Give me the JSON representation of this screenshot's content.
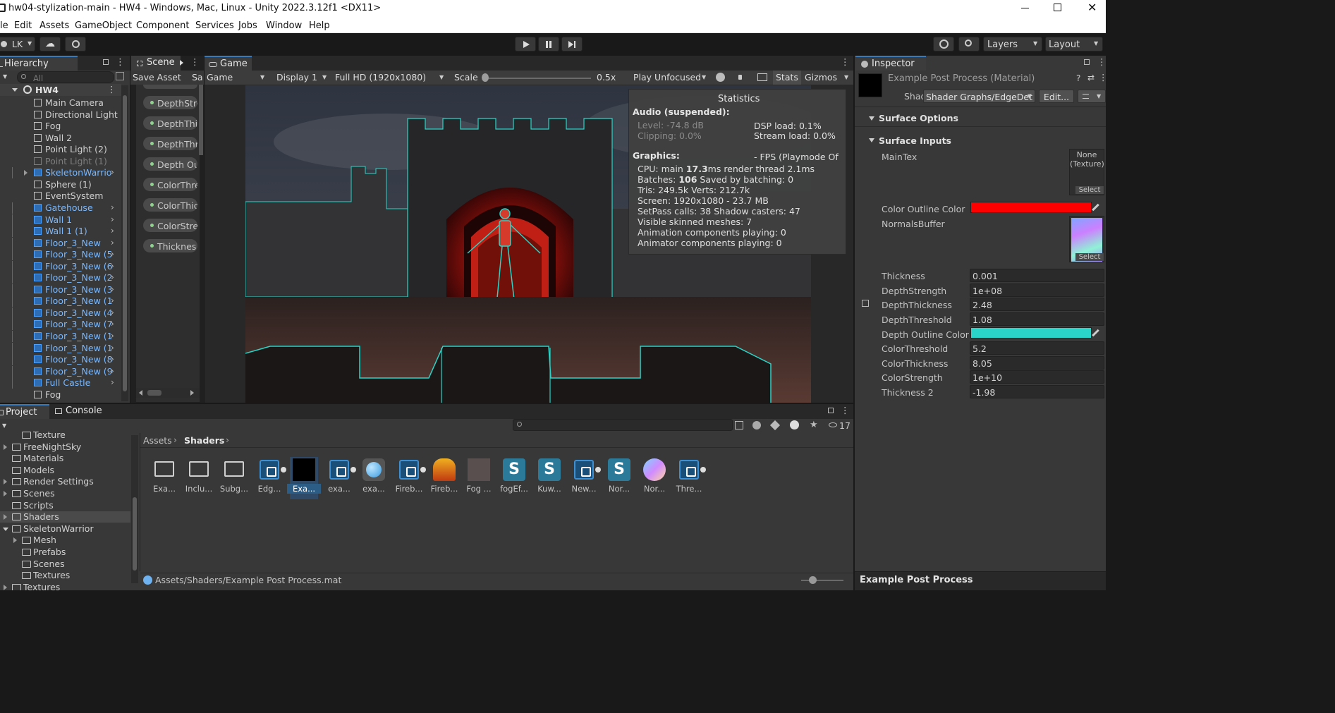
{
  "window": {
    "title": "hw04-stylization-main - HW4 - Windows, Mac, Linux - Unity 2022.3.12f1 <DX11>"
  },
  "menu": [
    "le",
    "Edit",
    "Assets",
    "GameObject",
    "Component",
    "Services",
    "Jobs",
    "Window",
    "Help"
  ],
  "toolbar": {
    "account": "LK",
    "layers": "Layers",
    "layout": "Layout"
  },
  "hierarchy": {
    "tab": "Hierarchy",
    "search_placeholder": "All",
    "scene": "HW4",
    "items": [
      {
        "label": "Main Camera",
        "style": "normal"
      },
      {
        "label": "Directional Light",
        "style": "normal"
      },
      {
        "label": "Fog",
        "style": "normal"
      },
      {
        "label": "Wall 2",
        "style": "normal"
      },
      {
        "label": "Point Light (2)",
        "style": "normal"
      },
      {
        "label": "Point Light (1)",
        "style": "gray"
      },
      {
        "label": "SkeletonWarrio",
        "style": "blue"
      },
      {
        "label": "Sphere (1)",
        "style": "normal"
      },
      {
        "label": "EventSystem",
        "style": "normal"
      },
      {
        "label": "Gatehouse",
        "style": "blue"
      },
      {
        "label": "Wall 1",
        "style": "blue"
      },
      {
        "label": "Wall 1 (1)",
        "style": "blue"
      },
      {
        "label": "Floor_3_New",
        "style": "blue"
      },
      {
        "label": "Floor_3_New (5",
        "style": "blue"
      },
      {
        "label": "Floor_3_New (6",
        "style": "blue"
      },
      {
        "label": "Floor_3_New (2",
        "style": "blue"
      },
      {
        "label": "Floor_3_New (3",
        "style": "blue"
      },
      {
        "label": "Floor_3_New (1",
        "style": "blue"
      },
      {
        "label": "Floor_3_New (4",
        "style": "blue"
      },
      {
        "label": "Floor_3_New (7",
        "style": "blue"
      },
      {
        "label": "Floor_3_New (1",
        "style": "blue"
      },
      {
        "label": "Floor_3_New (1",
        "style": "blue"
      },
      {
        "label": "Floor_3_New (8",
        "style": "blue"
      },
      {
        "label": "Floor_3_New (9",
        "style": "blue"
      },
      {
        "label": "Full Castle",
        "style": "blue"
      },
      {
        "label": "Fog",
        "style": "normal"
      }
    ]
  },
  "scene": {
    "tab": "Scene",
    "save_asset": "Save Asset",
    "sa": "Sa",
    "props": [
      "DepthStre",
      "DepthThic",
      "DepthThre",
      "Depth Out",
      "ColorThre",
      "ColorThic",
      "ColorStre",
      "Thicknes"
    ]
  },
  "game": {
    "tab": "Game",
    "view": "Game",
    "display": "Display 1",
    "resolution": "Full HD (1920x1080)",
    "scale_label": "Scale",
    "scale_value": "0.5x",
    "play_mode": "Play Unfocused",
    "stats": "Stats",
    "gizmos": "Gizmos"
  },
  "stats": {
    "title": "Statistics",
    "audio_header": "Audio (suspended):",
    "level": "Level: -74.8 dB",
    "clipping": "Clipping: 0.0%",
    "dsp": "DSP load: 0.1%",
    "stream": "Stream load: 0.0%",
    "graphics_header": "Graphics:",
    "fps": "- FPS (Playmode Of",
    "cpu_a": "CPU: main ",
    "cpu_b": "17.3",
    "cpu_c": "ms  render thread 2.1ms",
    "batches_a": "Batches: ",
    "batches_b": "106",
    "batches_c": "   Saved by batching: 0",
    "tris": "Tris: 249.5k      Verts: 212.7k",
    "screen": "Screen: 1920x1080 - 23.7 MB",
    "setpass": "SetPass calls: 38          Shadow casters: 47",
    "skinned": "Visible skinned meshes: 7",
    "anim": "Animation components playing: 0",
    "animator": "Animator components playing: 0"
  },
  "inspector": {
    "tab": "Inspector",
    "material": "Example Post Process (Material)",
    "shader_label": "Shader",
    "shader_value": "Shader Graphs/EdgeDet",
    "edit": "Edit...",
    "surface_options": "Surface Options",
    "surface_inputs": "Surface Inputs",
    "maintex": "MainTex",
    "none_texture": "None\n(Texture)",
    "select": "Select",
    "color_outline": "Color Outline Color",
    "color_outline_hex": "#ff0000",
    "normals_buffer": "NormalsBuffer",
    "fields": [
      {
        "label": "Thickness",
        "value": "0.001"
      },
      {
        "label": "DepthStrength",
        "value": "1e+08"
      },
      {
        "label": "DepthThickness",
        "value": "2.48"
      },
      {
        "label": "DepthThreshold",
        "value": "1.08"
      }
    ],
    "depth_outline": "Depth Outline Color",
    "depth_outline_hex": "#2ad4c8",
    "fields2": [
      {
        "label": "ColorThreshold",
        "value": "5.2"
      },
      {
        "label": "ColorThickness",
        "value": "8.05"
      },
      {
        "label": "ColorStrength",
        "value": "1e+10"
      },
      {
        "label": "Thickness 2",
        "value": "-1.98"
      }
    ],
    "footer": "Example Post Process"
  },
  "project": {
    "tab": "Project",
    "console_tab": "Console",
    "count": "17",
    "breadcrumb": [
      "Assets",
      "Shaders"
    ],
    "tree": [
      {
        "label": "Texture",
        "indent": 1
      },
      {
        "label": "FreeNightSky",
        "indent": 0
      },
      {
        "label": "Materials",
        "indent": 0
      },
      {
        "label": "Models",
        "indent": 0
      },
      {
        "label": "Render Settings",
        "indent": 0
      },
      {
        "label": "Scenes",
        "indent": 0
      },
      {
        "label": "Scripts",
        "indent": 0
      },
      {
        "label": "Shaders",
        "indent": 0
      },
      {
        "label": "SkeletonWarrior",
        "indent": 0
      },
      {
        "label": "Mesh",
        "indent": 1
      },
      {
        "label": "Prefabs",
        "indent": 1
      },
      {
        "label": "Scenes",
        "indent": 1
      },
      {
        "label": "Textures",
        "indent": 1
      },
      {
        "label": "Textures",
        "indent": 0
      }
    ],
    "assets": [
      "Exa...",
      "Inclu...",
      "Subg...",
      "Edg...",
      "Exa...",
      "exa...",
      "exa...",
      "Fireb...",
      "Fireb...",
      "Fog ...",
      "fogEf...",
      "Kuw...",
      "New...",
      "Nor...",
      "Nor...",
      "Thre..."
    ],
    "status_path": "Assets/Shaders/Example Post Process.mat"
  }
}
